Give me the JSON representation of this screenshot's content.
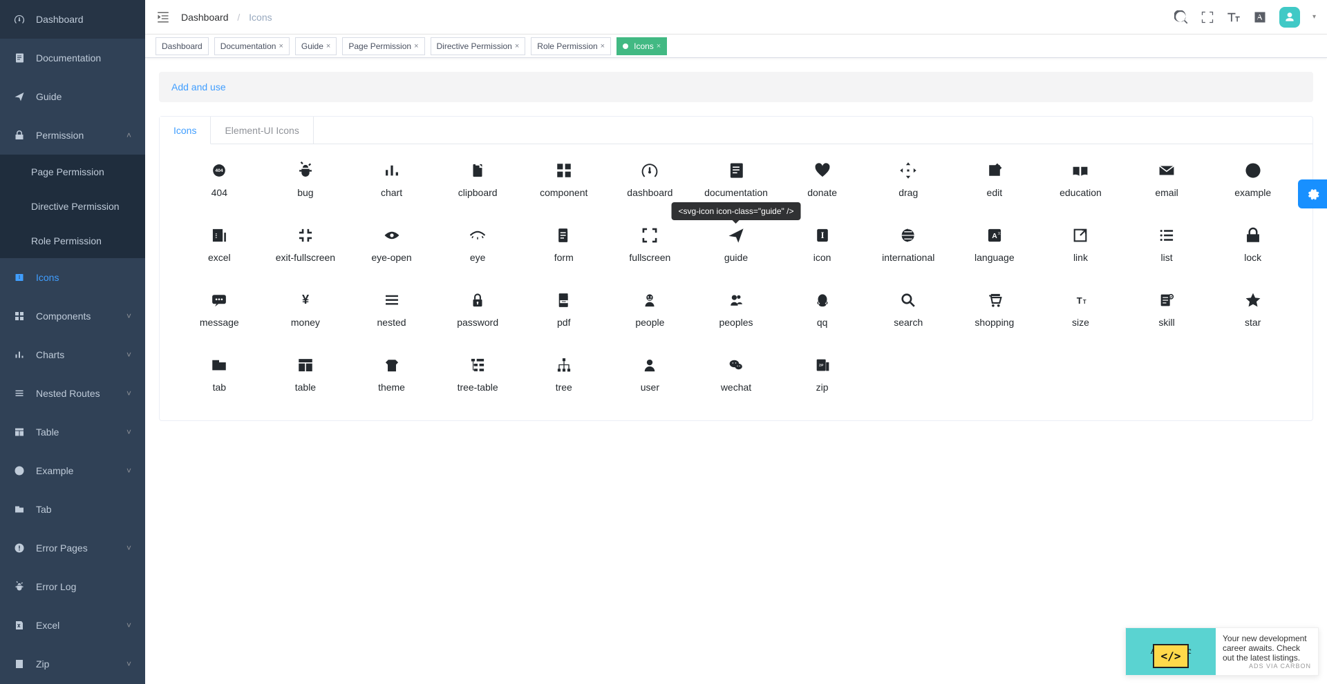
{
  "sidebar": {
    "items": [
      {
        "label": "Dashboard",
        "icon": "dashboard-icon",
        "type": "item"
      },
      {
        "label": "Documentation",
        "icon": "documentation-icon",
        "type": "item"
      },
      {
        "label": "Guide",
        "icon": "guide-icon",
        "type": "item"
      },
      {
        "label": "Permission",
        "icon": "lock-icon",
        "type": "submenu",
        "arrow": "up",
        "children": [
          {
            "label": "Page Permission"
          },
          {
            "label": "Directive Permission"
          },
          {
            "label": "Role Permission"
          }
        ]
      },
      {
        "label": "Icons",
        "icon": "icons-icon",
        "type": "item",
        "active": true
      },
      {
        "label": "Components",
        "icon": "component-icon",
        "type": "submenu",
        "arrow": "down"
      },
      {
        "label": "Charts",
        "icon": "chart-icon",
        "type": "submenu",
        "arrow": "down"
      },
      {
        "label": "Nested Routes",
        "icon": "nested-icon",
        "type": "submenu",
        "arrow": "down"
      },
      {
        "label": "Table",
        "icon": "table-icon",
        "type": "submenu",
        "arrow": "down"
      },
      {
        "label": "Example",
        "icon": "example-icon",
        "type": "submenu",
        "arrow": "down"
      },
      {
        "label": "Tab",
        "icon": "tab-icon",
        "type": "item"
      },
      {
        "label": "Error Pages",
        "icon": "error-icon",
        "type": "submenu",
        "arrow": "down"
      },
      {
        "label": "Error Log",
        "icon": "bug-icon",
        "type": "item"
      },
      {
        "label": "Excel",
        "icon": "excel-icon",
        "type": "submenu",
        "arrow": "down"
      },
      {
        "label": "Zip",
        "icon": "zip-icon",
        "type": "submenu",
        "arrow": "down"
      }
    ]
  },
  "breadcrumb": {
    "root": "Dashboard",
    "current": "Icons"
  },
  "tags": [
    {
      "label": "Dashboard",
      "closable": false
    },
    {
      "label": "Documentation",
      "closable": true
    },
    {
      "label": "Guide",
      "closable": true
    },
    {
      "label": "Page Permission",
      "closable": true
    },
    {
      "label": "Directive Permission",
      "closable": true
    },
    {
      "label": "Role Permission",
      "closable": true
    },
    {
      "label": "Icons",
      "closable": true,
      "active": true
    }
  ],
  "alert": {
    "text": "Add and use"
  },
  "tabs": {
    "icons": "Icons",
    "elementIcons": "Element-UI Icons",
    "active": "icons"
  },
  "icons": [
    "404",
    "bug",
    "chart",
    "clipboard",
    "component",
    "dashboard",
    "documentation",
    "donate",
    "drag",
    "edit",
    "education",
    "email",
    "example",
    "excel",
    "exit-fullscreen",
    "eye-open",
    "eye",
    "form",
    "fullscreen",
    "guide",
    "icon",
    "international",
    "language",
    "link",
    "list",
    "lock",
    "message",
    "money",
    "nested",
    "password",
    "pdf",
    "people",
    "peoples",
    "qq",
    "search",
    "shopping",
    "size",
    "skill",
    "star",
    "tab",
    "table",
    "theme",
    "tree-table",
    "tree",
    "user",
    "wechat",
    "zip"
  ],
  "tooltip": {
    "targetIcon": "guide",
    "text": "<svg-icon icon-class=\"guide\" />"
  },
  "ad": {
    "headline": "Authentic",
    "code": "</>",
    "text": "Your new development career awaits. Check out the latest listings.",
    "via": "ADS VIA CARBON"
  }
}
